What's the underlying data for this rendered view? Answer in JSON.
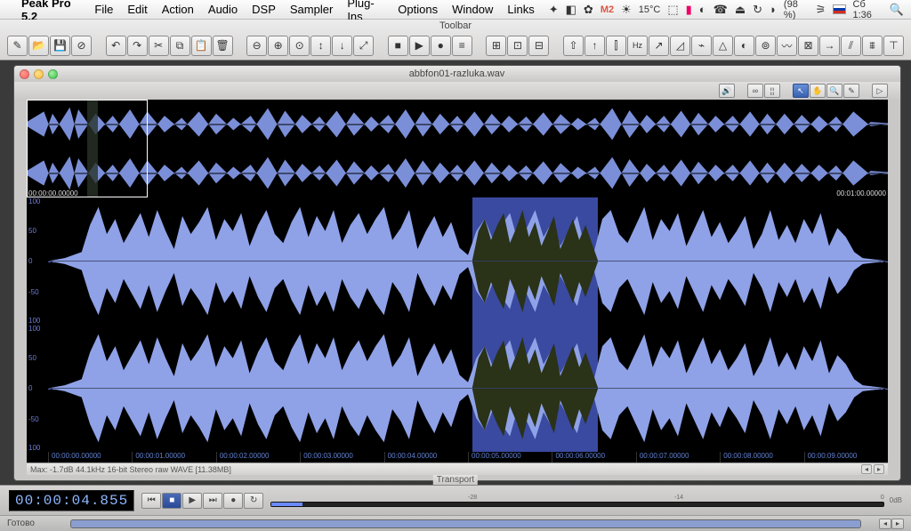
{
  "menubar": {
    "app_name": "Peak Pro 5.2",
    "items": [
      "File",
      "Edit",
      "Action",
      "Audio",
      "DSP",
      "Sampler",
      "Plug-Ins",
      "Options",
      "Window",
      "Links"
    ],
    "right": {
      "gmail_label": "M",
      "gmail_count": "2",
      "temp": "15°C",
      "battery": "(98 %)",
      "clock": "Сб 1:36"
    }
  },
  "toolbar": {
    "title": "Toolbar"
  },
  "document": {
    "title": "abbfon01-razluka.wav",
    "overview_time_start": "00:00:00.00000",
    "overview_time_end": "00:01:00.00000",
    "axis": {
      "p100": "100",
      "p50": "50",
      "zero": "0",
      "m50": "-50",
      "m100": "100"
    },
    "time_ticks": [
      "00:00:00.00000",
      "00:00:01.00000",
      "00:00:02.00000",
      "00:00:03.00000",
      "00:00:04.00000",
      "00:00:05.00000",
      "00:00:06.00000",
      "00:00:07.00000",
      "00:00:08.00000",
      "00:00:09.00000"
    ],
    "info": "Max: -1.7dB   44.1kHz 16-bit Stereo raw  WAVE [11.38MB]"
  },
  "transport": {
    "title": "Transport",
    "timecode": "00:00:04.855",
    "meter_ticks": [
      "-28",
      "-14",
      "0"
    ],
    "meter_end": "0dB"
  },
  "statusbar": {
    "text": "Готово"
  }
}
